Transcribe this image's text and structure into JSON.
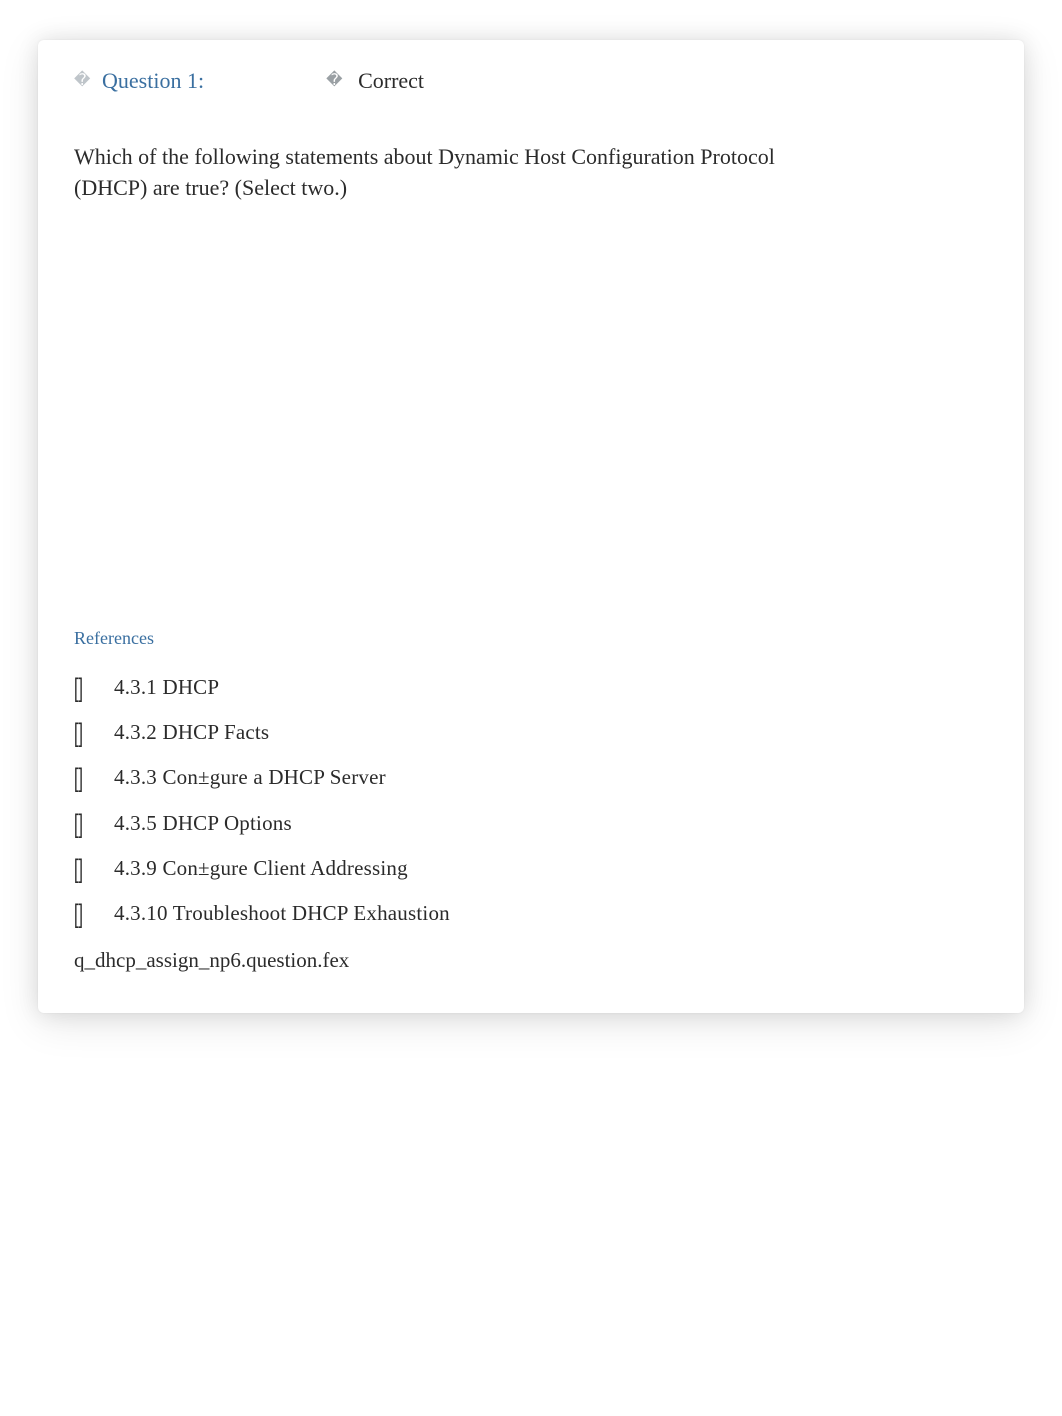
{
  "header": {
    "question_label": "Question 1:",
    "status_label": "Correct"
  },
  "question": {
    "text": "Which of the following statements about Dynamic Host Configuration Protocol (DHCP) are true? (Select two.)"
  },
  "references": {
    "heading": "References",
    "items": [
      {
        "label": "4.3.1 DHCP"
      },
      {
        "label": "4.3.2 DHCP Facts"
      },
      {
        "label": "4.3.3 Con±gure a DHCP Server"
      },
      {
        "label": "4.3.5 DHCP Options"
      },
      {
        "label": "4.3.9 Con±gure Client Addressing"
      },
      {
        "label": "4.3.10 Troubleshoot DHCP Exhaustion"
      }
    ]
  },
  "source_line": "q_dhcp_assign_np6.question.fex",
  "icons": {
    "header_glyph": "�",
    "status_glyph": "�",
    "ref_bullet": "[]"
  }
}
